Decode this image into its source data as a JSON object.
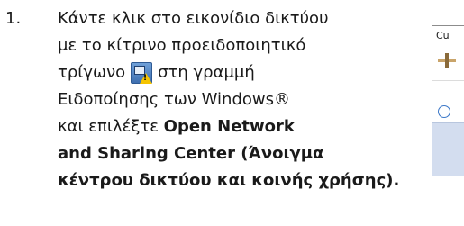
{
  "step": {
    "number": "1.",
    "line1": "Κάντε κλικ στο εικονίδιο δικτύου",
    "line2": "με το κίτρινο προειδοποιητικό",
    "line3_before": "τρίγωνο",
    "line3_after": "στη γραμμή",
    "line4": "Ειδοποίησης των Windows®",
    "line5_plain": "και επιλέξτε ",
    "line5_bold": "Open Network",
    "line6": "and Sharing Center (Άνοιγμα",
    "line7": "κέντρου δικτύου και κοινής χρήσης)."
  },
  "popup": {
    "title": "Cu"
  },
  "icons": {
    "tray": "network-warning-icon",
    "popup_network": "network-icon"
  },
  "colors": {
    "warning": "#f5c400",
    "tray_blue": "#3e6fb0",
    "popup_footer": "#d3ddef"
  }
}
